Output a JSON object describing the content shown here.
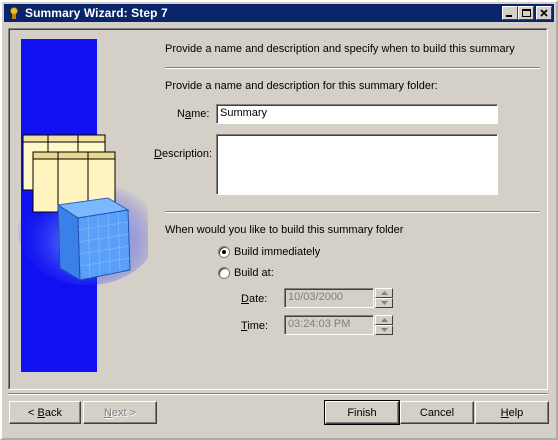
{
  "window": {
    "title": "Summary Wizard: Step 7"
  },
  "main": {
    "heading": "Provide a name and description and specify when to build this summary",
    "section1_heading": "Provide a name and description for this summary folder:",
    "name_label_pre": "N",
    "name_label_u": "a",
    "name_label_post": "me:",
    "name_value": "Summary",
    "description_label_pre": "",
    "description_label_u": "D",
    "description_label_post": "escription:",
    "description_value": "",
    "section2_heading": "When would you like to build this summary folder",
    "build_immediately_label": "Build immediately",
    "build_immediately_checked": true,
    "build_at_label": "Build at:",
    "build_at_checked": false,
    "date_label_u": "D",
    "date_label_post": "ate:",
    "date_value": "10/03/2000",
    "time_label_u": "T",
    "time_label_post": "ime:",
    "time_value": "03:24:03 PM"
  },
  "footer": {
    "back_pre": "< ",
    "back_u": "B",
    "back_post": "ack",
    "next_pre": "",
    "next_u": "N",
    "next_post": "ext >",
    "finish_label": "Finish",
    "cancel_label": "Cancel",
    "help_u": "H",
    "help_post": "elp"
  },
  "colors": {
    "title_bar": "#0a246a",
    "blue_strip": "#1010f0",
    "face": "#d4d0c8"
  }
}
